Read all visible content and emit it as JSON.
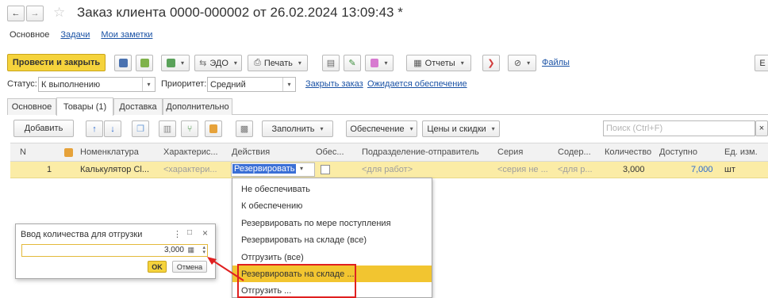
{
  "nav": {
    "back_icon": "arrow-left",
    "forward_icon": "arrow-right",
    "star_icon": "star"
  },
  "window": {
    "title": "Заказ клиента 0000-000002 от 26.02.2024 13:09:43 *"
  },
  "top_tabs": {
    "main": "Основное",
    "tasks": "Задачи",
    "notes": "Мои заметки"
  },
  "toolbar": {
    "post_close": "Провести и закрыть",
    "edo": "ЭДО",
    "print": "Печать",
    "reports": "Отчеты",
    "files": "Файлы",
    "cut_label": "E"
  },
  "status": {
    "status_label": "Статус:",
    "status_value": "К выполнению",
    "priority_label": "Приоритет:",
    "priority_value": "Средний",
    "close_order": "Закрыть заказ",
    "awaiting": "Ожидается обеспечение"
  },
  "inner_tabs": {
    "main": "Основное",
    "goods": "Товары (1)",
    "delivery": "Доставка",
    "extra": "Дополнительно"
  },
  "grid_toolbar": {
    "add": "Добавить",
    "fill": "Заполнить",
    "provision": "Обеспечение",
    "prices": "Цены и скидки",
    "search_placeholder": "Поиск (Ctrl+F)",
    "clear": "×"
  },
  "table": {
    "headers": {
      "n": "N",
      "item": "Номенклатура",
      "char": "Характерис...",
      "actions": "Действия",
      "obes": "Обес...",
      "dept": "Подразделение-отправитель",
      "series": "Серия",
      "content": "Содер...",
      "qty": "Количество",
      "avail": "Доступно",
      "unit": "Ед. изм."
    },
    "row": {
      "n": "1",
      "item": "Калькулятор Cl...",
      "char": "<характери...",
      "action": "Резервировать п",
      "dept": "<для работ>",
      "series": "<серия не ...",
      "content": "<для р...",
      "qty": "3,000",
      "avail": "7,000",
      "unit": "шт"
    }
  },
  "menu": {
    "items": [
      "Не обеспечивать",
      "К обеспечению",
      "Резервировать по мере поступления",
      "Резервировать на складе (все)",
      "Отгрузить (все)",
      "Резервировать на складе ...",
      "Отгрузить ..."
    ]
  },
  "dialog": {
    "title": "Ввод количества для отгрузки",
    "qty": "3,000",
    "ok": "OK",
    "cancel": "Отмена",
    "menu_icon": "⋮",
    "max_icon": "□",
    "close_icon": "×"
  },
  "colors": {
    "primary_button": "#f5d33c",
    "selected_row": "#fbeca6",
    "menu_highlight": "#f2c530",
    "annotation": "#e02020",
    "link": "#1a52a5"
  }
}
